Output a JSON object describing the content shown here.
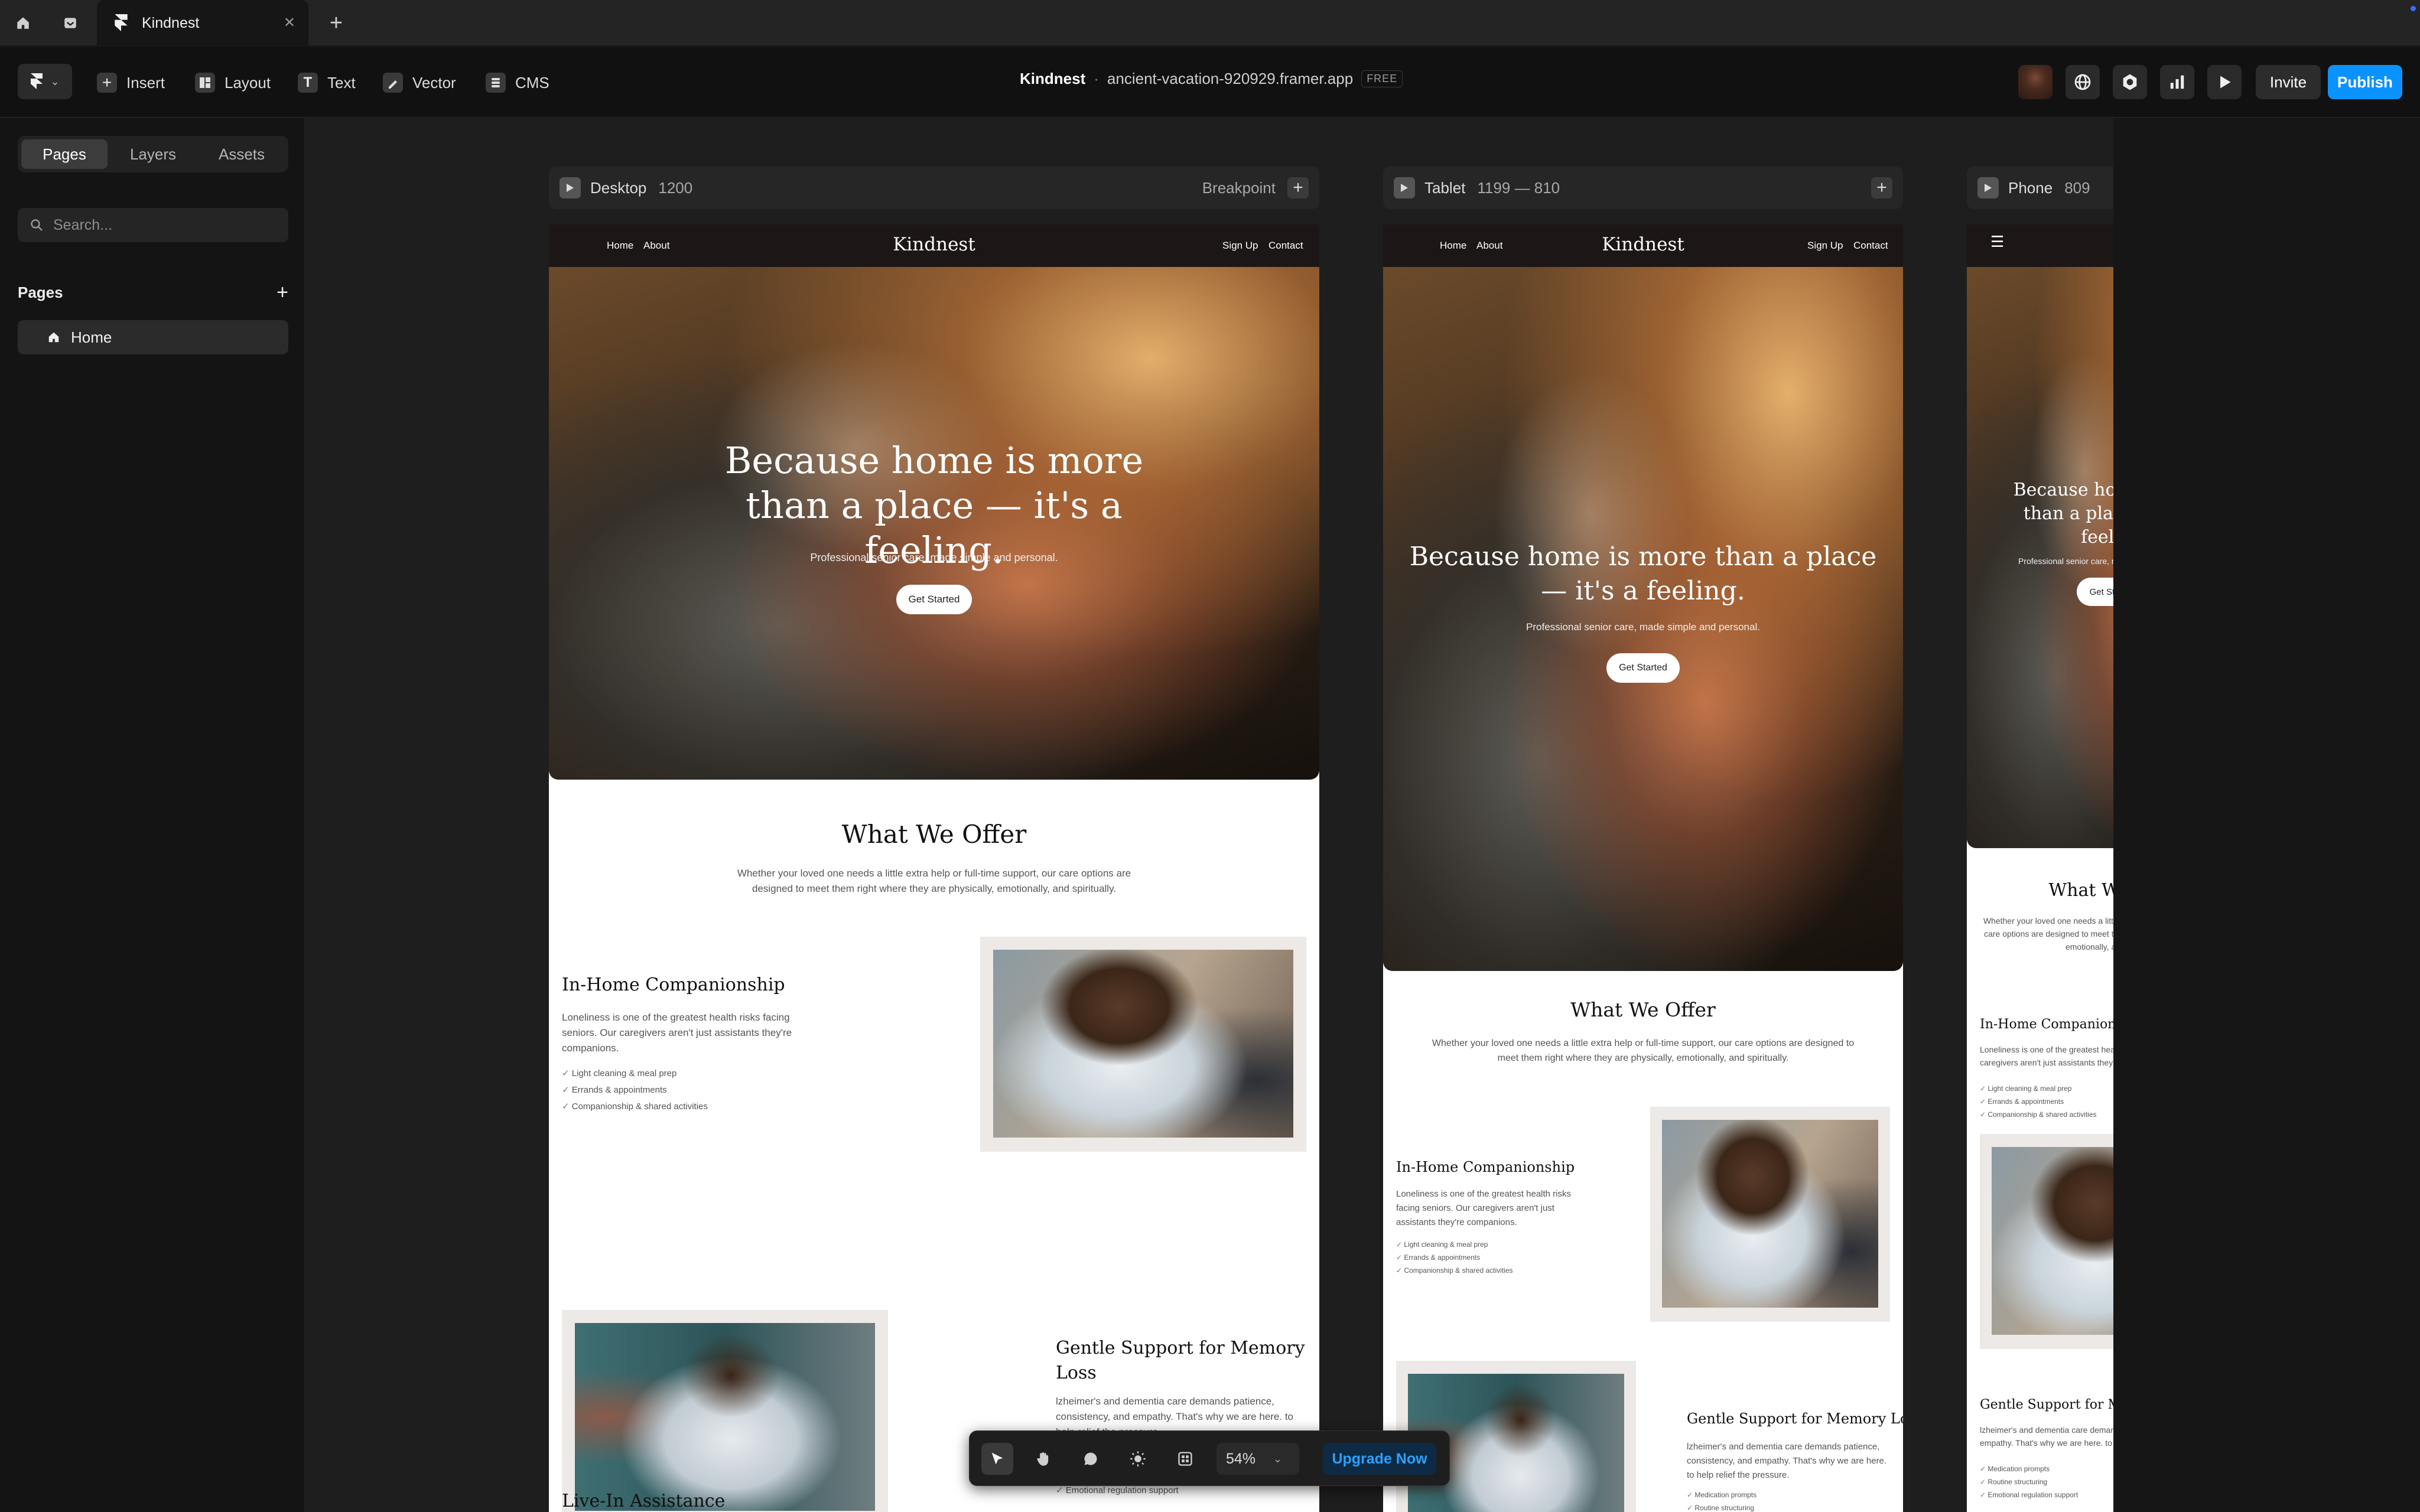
{
  "browser": {
    "tab_title": "Kindnest"
  },
  "toolbar": {
    "tools": [
      "Insert",
      "Layout",
      "Text",
      "Vector",
      "CMS"
    ],
    "project_name": "Kindnest",
    "separator": "·",
    "domain": "ancient-vacation-920929.framer.app",
    "plan_badge": "FREE",
    "invite_label": "Invite",
    "publish_label": "Publish",
    "publish_color": "#0a93ff"
  },
  "sidebar": {
    "tabs": [
      "Pages",
      "Layers",
      "Assets"
    ],
    "active_tab": "Pages",
    "search_placeholder": "Search...",
    "section_title": "Pages",
    "pages": [
      "Home"
    ]
  },
  "frames": {
    "desktop": {
      "label": "Desktop",
      "size": "1200",
      "breakpoint_label": "Breakpoint"
    },
    "tablet": {
      "label": "Tablet",
      "size": "1199 — 810"
    },
    "phone": {
      "label": "Phone",
      "size": "809"
    }
  },
  "site": {
    "nav_links_left": [
      "Home",
      "About"
    ],
    "brand": "Kindnest",
    "nav_links_right": [
      "Sign Up",
      "Contact"
    ],
    "hero_title": "Because home is more than a place — it's a feeling.",
    "hero_subtitle": "Professional senior care, made simple and personal.",
    "cta": "Get Started",
    "offer_title": "What We Offer",
    "offer_text": "Whether your loved one needs a little extra help or full-time support, our care options are designed to meet them right where they are physically, emotionally, and spiritually.",
    "companionship": {
      "title": "In-Home Companionship",
      "text": "Loneliness is one of the greatest health risks facing seniors. Our caregivers aren't just assistants they're companions.",
      "items": [
        "Light cleaning & meal prep",
        "Errands & appointments",
        "Companionship & shared activities"
      ]
    },
    "memory": {
      "title": "Gentle Support for Memory Loss",
      "text": "lzheimer's and dementia care demands patience, consistency, and empathy. That's why we are here. to help relief the pressure.",
      "items": [
        "Medication prompts",
        "Routine structuring",
        "Emotional regulation support"
      ]
    },
    "live_in_title": "Live-In Assistance"
  },
  "float_bar": {
    "zoom": "54%",
    "upgrade_label": "Upgrade Now"
  }
}
